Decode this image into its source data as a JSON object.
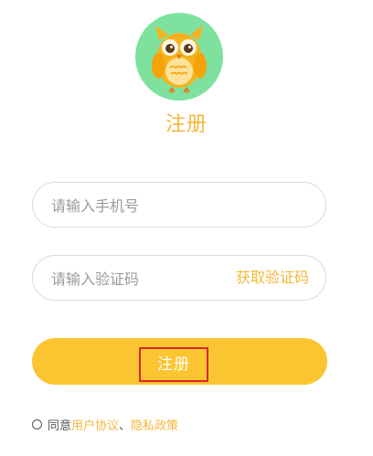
{
  "header": {
    "logo_icon": "owl-logo-icon",
    "title": "注册"
  },
  "form": {
    "phone_placeholder": "请输入手机号",
    "code_placeholder": "请输入验证码",
    "get_code_label": "获取验证码",
    "submit_label": "注册"
  },
  "agreement": {
    "prefix": "同意",
    "user_agreement": "用户协议",
    "separator": "、",
    "privacy_policy": "隐私政策"
  },
  "colors": {
    "accent": "#f4b83a",
    "button": "#fbc431",
    "logo_bg": "#7ee29e",
    "highlight_box": "#d9262a"
  }
}
